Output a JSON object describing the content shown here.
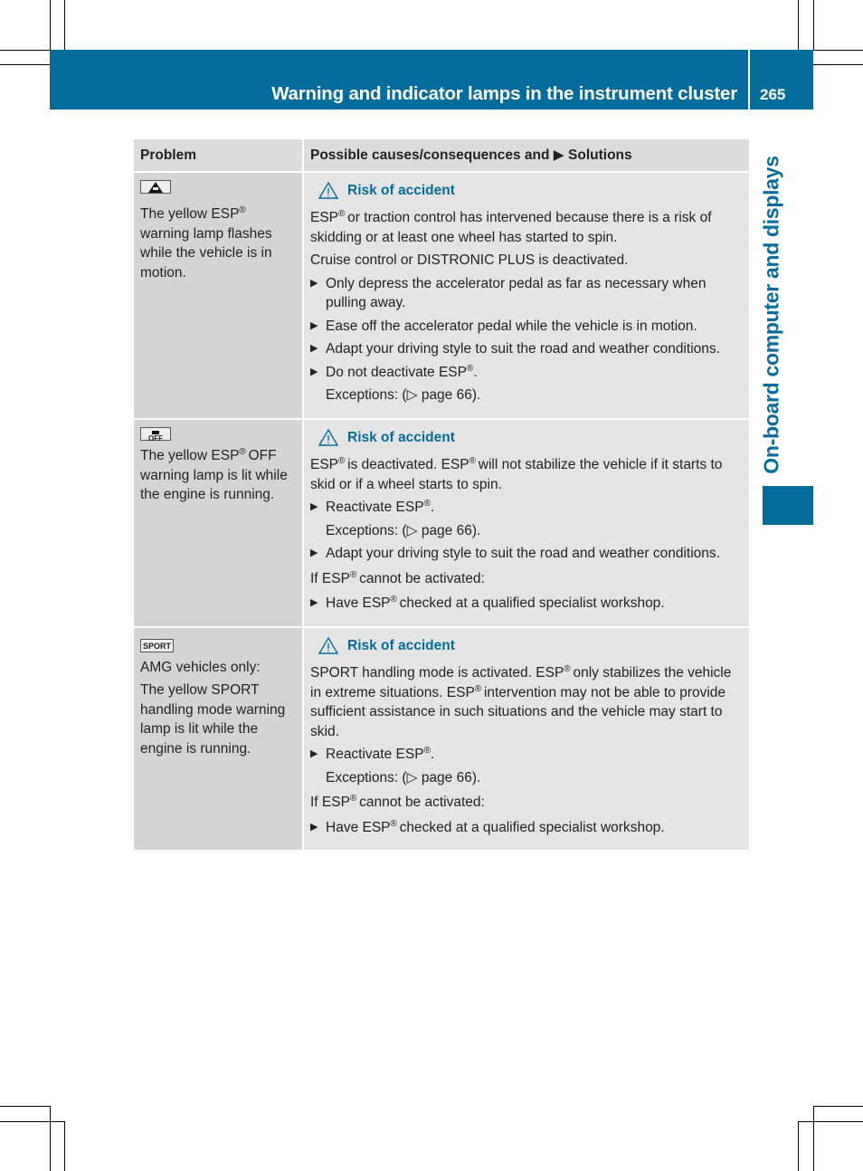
{
  "header": {
    "title": "Warning and indicator lamps in the instrument cluster",
    "page_number": "265"
  },
  "side_tab": {
    "label": "On-board computer and displays"
  },
  "colors": {
    "brand_blue": "#046d9e",
    "header_gray": "#dcdcdc",
    "problem_gray": "#d4d4d4",
    "solution_gray": "#e4e4e4"
  },
  "table": {
    "col_problem": "Problem",
    "col_solutions_a": "Possible causes/consequences and",
    "col_solutions_b": "Solutions",
    "rows": [
      {
        "icon": "esp-warning-lamp-icon",
        "problem": [
          "The yellow ESP",
          "® ",
          "warning lamp flashes while the vehicle is in motion."
        ],
        "warning": "Risk of accident",
        "p1": [
          "ESP",
          "® ",
          "or traction control has intervened because there is a risk of skidding or at least one wheel has started to spin."
        ],
        "p2": "Cruise control or DISTRONIC PLUS is deactivated.",
        "b1": "Only depress the accelerator pedal as far as necessary when pulling away.",
        "b2": "Ease off the accelerator pedal while the vehicle is in motion.",
        "b3": "Adapt your driving style to suit the road and weather conditions.",
        "b4": [
          "Do not deactivate ESP",
          "®",
          "."
        ],
        "exceptions": "Exceptions: (▷ page 66)."
      },
      {
        "icon": "esp-off-lamp-icon",
        "icon_label": "OFF",
        "problem": [
          "The yellow ESP",
          "® ",
          "OFF warning lamp is lit while the engine is running."
        ],
        "warning": "Risk of accident",
        "p1": [
          "ESP",
          "® ",
          "is deactivated. ESP",
          "® ",
          "will not stabilize the vehicle if it starts to skid or if a wheel starts to spin."
        ],
        "b1": [
          "Reactivate ESP",
          "®",
          "."
        ],
        "exceptions": "Exceptions: (▷ page 66).",
        "b2": "Adapt your driving style to suit the road and weather conditions.",
        "p2": [
          "If ESP",
          "® ",
          "cannot be activated:"
        ],
        "b3": [
          "Have ESP",
          "® ",
          "checked at a qualified specialist workshop."
        ]
      },
      {
        "icon": "sport-lamp-icon",
        "icon_label": "SPORT",
        "problem_a": "AMG vehicles only:",
        "problem_b": "The yellow SPORT handling mode warning lamp is lit while the engine is running.",
        "warning": "Risk of accident",
        "p1": [
          "SPORT handling mode is activated. ESP",
          "® ",
          "only stabilizes the vehicle in extreme situations. ESP",
          "® ",
          "intervention may not be able to provide sufficient assistance in such situations and the vehicle may start to skid."
        ],
        "b1": [
          "Reactivate ESP",
          "®",
          "."
        ],
        "exceptions": "Exceptions: (▷ page 66).",
        "p2": [
          "If ESP",
          "® ",
          "cannot be activated:"
        ],
        "b2": [
          "Have ESP",
          "® ",
          "checked at a qualified specialist workshop."
        ]
      }
    ]
  }
}
